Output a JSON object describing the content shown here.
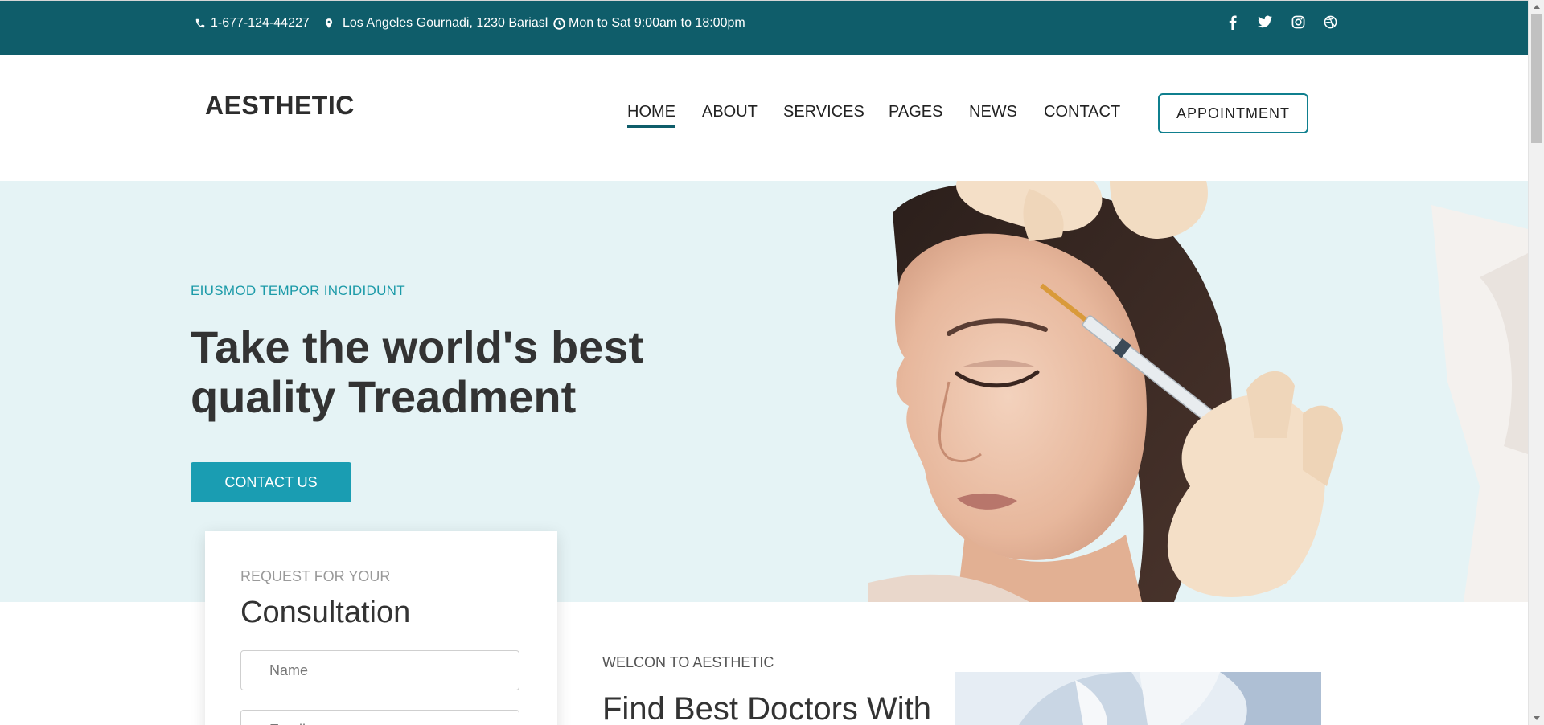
{
  "topbar": {
    "phone": "1-677-124-44227",
    "address": "Los Angeles Gournadi, 1230 Bariasl",
    "hours": "Mon to Sat 9:00am to 18:00pm",
    "social": [
      "facebook-icon",
      "twitter-icon",
      "instagram-icon",
      "dribbble-icon"
    ]
  },
  "header": {
    "logo": "AESTHETIC",
    "nav": [
      "HOME",
      "ABOUT",
      "SERVICES",
      "PAGES",
      "NEWS",
      "CONTACT"
    ],
    "active_nav": "HOME",
    "appointment_label": "APPOINTMENT"
  },
  "hero": {
    "eyebrow": "EIUSMOD TEMPOR INCIDIDUNT",
    "title_line1": "Take the world's best",
    "title_line2": "quality Treadment",
    "button_label": "CONTACT US"
  },
  "consultation": {
    "eyebrow": "REQUEST FOR YOUR",
    "title": "Consultation",
    "name_placeholder": "Name",
    "email_placeholder": "Email"
  },
  "welcome": {
    "eyebrow": "WELCON TO AESTHETIC",
    "title": "Find Best Doctors With"
  },
  "colors": {
    "topbar": "#0f5d6a",
    "accent": "#1a9db2",
    "hero_bg": "#e5f3f5"
  }
}
